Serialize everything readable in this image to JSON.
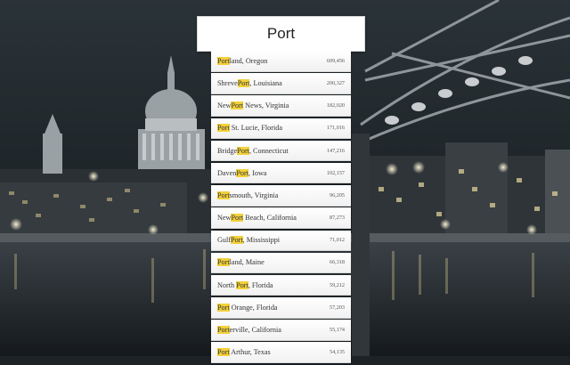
{
  "search": {
    "value": "Port",
    "placeholder": ""
  },
  "suggestions": [
    {
      "before": "",
      "match": "Port",
      "after": "land, Oregon",
      "population": "609,456"
    },
    {
      "before": "Shreve",
      "match": "Port",
      "after": ", Louisiana",
      "population": "200,327"
    },
    {
      "before": "New",
      "match": "Port",
      "after": " News, Virginia",
      "population": "182,020"
    },
    {
      "before": "",
      "match": "Port",
      "after": " St. Lucie, Florida",
      "population": "171,016"
    },
    {
      "before": "Bridge",
      "match": "Port",
      "after": ", Connecticut",
      "population": "147,216"
    },
    {
      "before": "Daven",
      "match": "Port",
      "after": ", Iowa",
      "population": "102,157"
    },
    {
      "before": "",
      "match": "Port",
      "after": "smouth, Virginia",
      "population": "96,205"
    },
    {
      "before": "New",
      "match": "Port",
      "after": " Beach, California",
      "population": "87,273"
    },
    {
      "before": "Gulf",
      "match": "Port",
      "after": ", Mississippi",
      "population": "71,012"
    },
    {
      "before": "",
      "match": "Port",
      "after": "land, Maine",
      "population": "66,318"
    },
    {
      "before": "North ",
      "match": "Port",
      "after": ", Florida",
      "population": "59,212"
    },
    {
      "before": "",
      "match": "Port",
      "after": " Orange, Florida",
      "population": "57,203"
    },
    {
      "before": "",
      "match": "Port",
      "after": "erville, California",
      "population": "55,174"
    },
    {
      "before": "",
      "match": "Port",
      "after": " Arthur, Texas",
      "population": "54,135"
    }
  ],
  "colors": {
    "highlight": "#f2d13b",
    "row_background": "#ffffff"
  },
  "background": {
    "icon": "city-night-skyline"
  }
}
